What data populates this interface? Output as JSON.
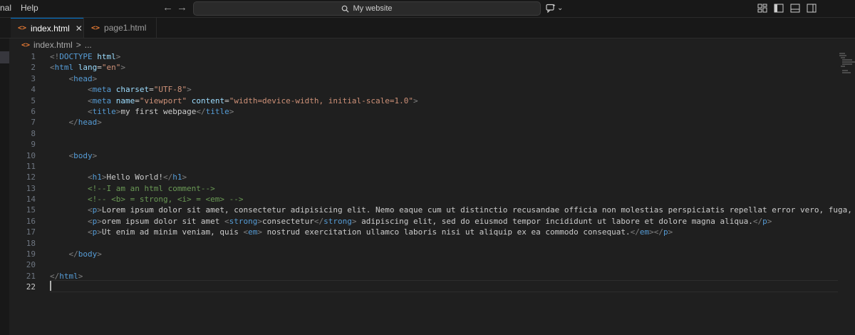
{
  "menu": {
    "partial_item": "nal",
    "help": "Help"
  },
  "search": {
    "text": "My website"
  },
  "tabs": [
    {
      "label": "index.html",
      "icon": "html-file-icon",
      "close": "✕"
    },
    {
      "label": "page1.html",
      "icon": "html-file-icon"
    }
  ],
  "breadcrumb": {
    "file": "index.html",
    "separator": ">",
    "ellipsis": "..."
  },
  "colors": {
    "tag": "#569cd6",
    "attr": "#9cdcfe",
    "value": "#ce9178",
    "comment": "#6a9955",
    "bracket": "#808080",
    "text": "#cccccc",
    "accent": "#0078d4"
  },
  "editor": {
    "current_line": 22,
    "lines": [
      {
        "n": "1",
        "tokens": [
          [
            "bracket",
            "<!"
          ],
          [
            "tag",
            "DOCTYPE"
          ],
          [
            "text",
            " "
          ],
          [
            "attr",
            "html"
          ],
          [
            "bracket",
            ">"
          ]
        ]
      },
      {
        "n": "2",
        "tokens": [
          [
            "bracket",
            "<"
          ],
          [
            "tag",
            "html"
          ],
          [
            "text",
            " "
          ],
          [
            "attr",
            "lang"
          ],
          [
            "text",
            "="
          ],
          [
            "val",
            "\"en\""
          ],
          [
            "bracket",
            ">"
          ]
        ]
      },
      {
        "n": "3",
        "tokens": [
          [
            "text",
            "    "
          ],
          [
            "bracket",
            "<"
          ],
          [
            "tag",
            "head"
          ],
          [
            "bracket",
            ">"
          ]
        ]
      },
      {
        "n": "4",
        "tokens": [
          [
            "text",
            "        "
          ],
          [
            "bracket",
            "<"
          ],
          [
            "tag",
            "meta"
          ],
          [
            "text",
            " "
          ],
          [
            "attr",
            "charset"
          ],
          [
            "text",
            "="
          ],
          [
            "val",
            "\"UTF-8\""
          ],
          [
            "bracket",
            ">"
          ]
        ]
      },
      {
        "n": "5",
        "tokens": [
          [
            "text",
            "        "
          ],
          [
            "bracket",
            "<"
          ],
          [
            "tag",
            "meta"
          ],
          [
            "text",
            " "
          ],
          [
            "attr",
            "name"
          ],
          [
            "text",
            "="
          ],
          [
            "val",
            "\"viewport\""
          ],
          [
            "text",
            " "
          ],
          [
            "attr",
            "content"
          ],
          [
            "text",
            "="
          ],
          [
            "val",
            "\"width=device-width, initial-scale=1.0\""
          ],
          [
            "bracket",
            ">"
          ]
        ]
      },
      {
        "n": "6",
        "tokens": [
          [
            "text",
            "        "
          ],
          [
            "bracket",
            "<"
          ],
          [
            "tag",
            "title"
          ],
          [
            "bracket",
            ">"
          ],
          [
            "text",
            "my first webpage"
          ],
          [
            "bracket",
            "</"
          ],
          [
            "tag",
            "title"
          ],
          [
            "bracket",
            ">"
          ]
        ]
      },
      {
        "n": "7",
        "tokens": [
          [
            "text",
            "    "
          ],
          [
            "bracket",
            "</"
          ],
          [
            "tag",
            "head"
          ],
          [
            "bracket",
            ">"
          ]
        ]
      },
      {
        "n": "8",
        "tokens": []
      },
      {
        "n": "9",
        "tokens": []
      },
      {
        "n": "10",
        "tokens": [
          [
            "text",
            "    "
          ],
          [
            "bracket",
            "<"
          ],
          [
            "tag",
            "body"
          ],
          [
            "bracket",
            ">"
          ]
        ]
      },
      {
        "n": "11",
        "tokens": []
      },
      {
        "n": "12",
        "tokens": [
          [
            "text",
            "        "
          ],
          [
            "bracket",
            "<"
          ],
          [
            "tag",
            "h1"
          ],
          [
            "bracket",
            ">"
          ],
          [
            "text",
            "Hello World!"
          ],
          [
            "bracket",
            "</"
          ],
          [
            "tag",
            "h1"
          ],
          [
            "bracket",
            ">"
          ]
        ]
      },
      {
        "n": "13",
        "tokens": [
          [
            "text",
            "        "
          ],
          [
            "comment",
            "<!--I am an html comment-->"
          ]
        ]
      },
      {
        "n": "14",
        "tokens": [
          [
            "text",
            "        "
          ],
          [
            "comment",
            "<!-- <b> = strong, <i> = <em> -->"
          ]
        ]
      },
      {
        "n": "15",
        "tokens": [
          [
            "text",
            "        "
          ],
          [
            "bracket",
            "<"
          ],
          [
            "tag",
            "p"
          ],
          [
            "bracket",
            ">"
          ],
          [
            "text",
            "Lorem ipsum dolor sit amet, consectetur adipisicing elit. Nemo eaque cum ut distinctio recusandae officia non molestias perspiciatis repellat error vero, fuga, ratione"
          ]
        ]
      },
      {
        "n": "16",
        "tokens": [
          [
            "text",
            "        "
          ],
          [
            "bracket",
            "<"
          ],
          [
            "tag",
            "p"
          ],
          [
            "bracket",
            ">"
          ],
          [
            "text",
            "orem ipsum dolor sit amet "
          ],
          [
            "bracket",
            "<"
          ],
          [
            "tag",
            "strong"
          ],
          [
            "bracket",
            ">"
          ],
          [
            "text",
            "consectetur"
          ],
          [
            "bracket",
            "</"
          ],
          [
            "tag",
            "strong"
          ],
          [
            "bracket",
            ">"
          ],
          [
            "text",
            " adipiscing elit, sed do eiusmod tempor incididunt ut labore et dolore magna aliqua."
          ],
          [
            "bracket",
            "</"
          ],
          [
            "tag",
            "p"
          ],
          [
            "bracket",
            ">"
          ]
        ]
      },
      {
        "n": "17",
        "tokens": [
          [
            "text",
            "        "
          ],
          [
            "bracket",
            "<"
          ],
          [
            "tag",
            "p"
          ],
          [
            "bracket",
            ">"
          ],
          [
            "text",
            "Ut enim ad minim veniam, quis "
          ],
          [
            "bracket",
            "<"
          ],
          [
            "tag",
            "em"
          ],
          [
            "bracket",
            ">"
          ],
          [
            "text",
            " nostrud exercitation ullamco laboris nisi ut aliquip ex ea commodo consequat."
          ],
          [
            "bracket",
            "</"
          ],
          [
            "tag",
            "em"
          ],
          [
            "bracket",
            "></"
          ],
          [
            "tag",
            "p"
          ],
          [
            "bracket",
            ">"
          ]
        ]
      },
      {
        "n": "18",
        "tokens": []
      },
      {
        "n": "19",
        "tokens": [
          [
            "text",
            "    "
          ],
          [
            "bracket",
            "</"
          ],
          [
            "tag",
            "body"
          ],
          [
            "bracket",
            ">"
          ]
        ]
      },
      {
        "n": "20",
        "tokens": []
      },
      {
        "n": "21",
        "tokens": [
          [
            "bracket",
            "</"
          ],
          [
            "tag",
            "html"
          ],
          [
            "bracket",
            ">"
          ]
        ]
      },
      {
        "n": "22",
        "tokens": []
      }
    ]
  }
}
